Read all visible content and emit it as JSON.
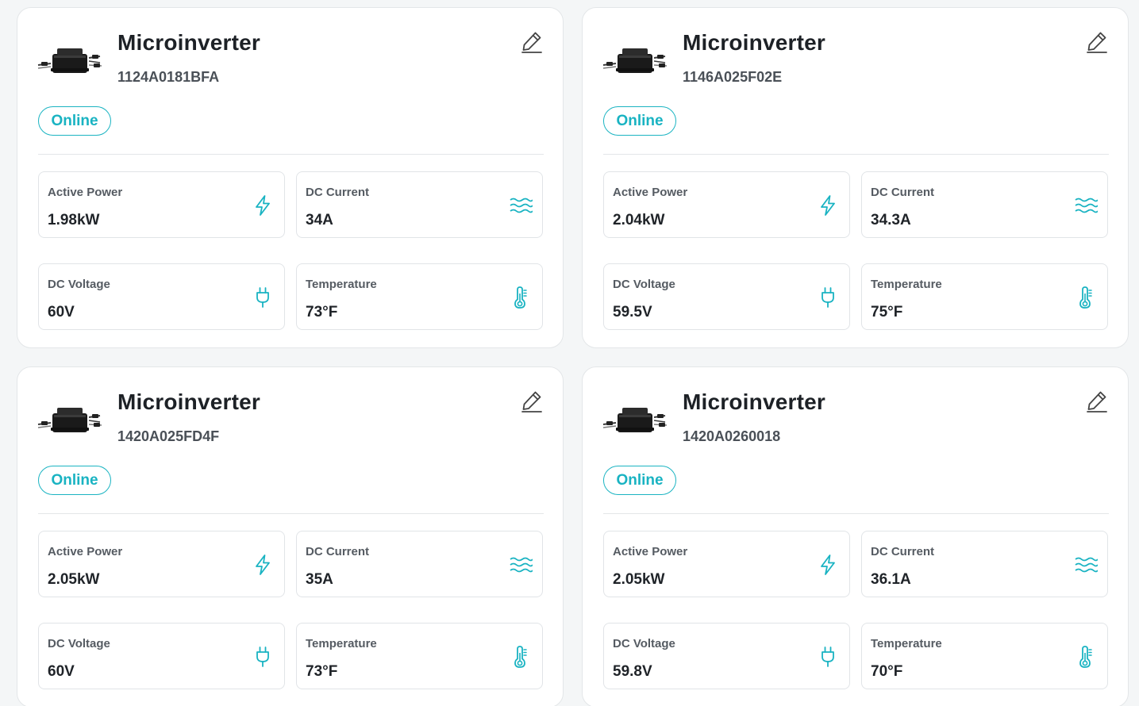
{
  "colors": {
    "accent": "#19b3c2",
    "card_background": "#ffffff",
    "page_background": "#f4f6f7",
    "title_text": "#1d2126",
    "muted_text": "#555b62"
  },
  "labels": {
    "active_power": "Active Power",
    "dc_current": "DC Current",
    "dc_voltage": "DC Voltage",
    "temperature": "Temperature"
  },
  "icons": {
    "device": "microinverter-device-icon",
    "edit": "pencil-icon",
    "active_power": "lightning-bolt-icon",
    "dc_current": "waves-icon",
    "dc_voltage": "plug-icon",
    "temperature": "thermometer-icon"
  },
  "devices": [
    {
      "title": "Microinverter",
      "serial": "1124A0181BFA",
      "status": "Online",
      "active_power": "1.98kW",
      "dc_current": "34A",
      "dc_voltage": "60V",
      "temperature": "73°F"
    },
    {
      "title": "Microinverter",
      "serial": "1146A025F02E",
      "status": "Online",
      "active_power": "2.04kW",
      "dc_current": "34.3A",
      "dc_voltage": "59.5V",
      "temperature": "75°F"
    },
    {
      "title": "Microinverter",
      "serial": "1420A025FD4F",
      "status": "Online",
      "active_power": "2.05kW",
      "dc_current": "35A",
      "dc_voltage": "60V",
      "temperature": "73°F"
    },
    {
      "title": "Microinverter",
      "serial": "1420A0260018",
      "status": "Online",
      "active_power": "2.05kW",
      "dc_current": "36.1A",
      "dc_voltage": "59.8V",
      "temperature": "70°F"
    }
  ]
}
